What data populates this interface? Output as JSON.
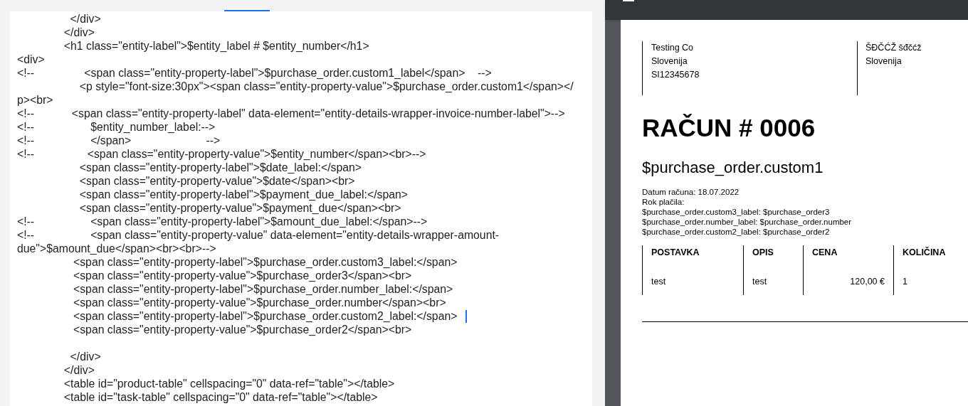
{
  "editor": {
    "lines": [
      {
        "kind": "code",
        "text": "                 </div>"
      },
      {
        "kind": "code",
        "text": "               </div>"
      },
      {
        "kind": "code",
        "text": "               <h1 class=\"entity-label\">$entity_label # $entity_number</h1>"
      },
      {
        "kind": "code",
        "text": "<div>"
      },
      {
        "kind": "code",
        "text": "<!--                <span class=\"entity-property-label\">$purchase_order.custom1_label</span>    -->"
      },
      {
        "kind": "code",
        "text": "                    <p style=\"font-size:30px\"><span class=\"entity-property-value\">$purchase_order.custom1</span></"
      },
      {
        "kind": "code",
        "text": "p><br>"
      },
      {
        "kind": "code",
        "text": "<!--            <span class=\"entity-property-label\" data-element=\"entity-details-wrapper-invoice-number-label\">-->"
      },
      {
        "kind": "code",
        "text": "<!--                  $entity_number_label:-->"
      },
      {
        "kind": "code",
        "text": "<!--                  </span>                        -->"
      },
      {
        "kind": "code",
        "text": "<!--                 <span class=\"entity-property-value\">$entity_number</span><br>-->"
      },
      {
        "kind": "code",
        "text": "                    <span class=\"entity-property-label\">$date_label:</span>"
      },
      {
        "kind": "code",
        "text": "                    <span class=\"entity-property-value\">$date</span><br>"
      },
      {
        "kind": "code",
        "text": "                    <span class=\"entity-property-label\">$payment_due_label:</span>"
      },
      {
        "kind": "code",
        "text": "                    <span class=\"entity-property-value\">$payment_due</span><br>"
      },
      {
        "kind": "code",
        "text": "<!--                  <span class=\"entity-property-label\">$amount_due_label:</span>-->"
      },
      {
        "kind": "code",
        "text": "<!--                  <span class=\"entity-property-value\" data-element=\"entity-details-wrapper-amount-"
      },
      {
        "kind": "code",
        "text": "due\">$amount_due</span><br><br>-->"
      },
      {
        "kind": "code",
        "text": "                  <span class=\"entity-property-label\">$purchase_order.custom3_label:</span>"
      },
      {
        "kind": "code",
        "text": "                  <span class=\"entity-property-value\">$purchase_order3</span><br>"
      },
      {
        "kind": "code",
        "text": "                  <span class=\"entity-property-label\">$purchase_order.number_label:</span>"
      },
      {
        "kind": "code",
        "text": "                  <span class=\"entity-property-value\">$purchase_order.number</span><br>"
      },
      {
        "kind": "cursor",
        "text": "                  <span class=\"entity-property-label\">$purchase_order.custom2_label:</span>"
      },
      {
        "kind": "code",
        "text": "                  <span class=\"entity-property-value\">$purchase_order2</span><br>"
      },
      {
        "kind": "blank"
      },
      {
        "kind": "code",
        "text": "                 </div>"
      },
      {
        "kind": "code",
        "text": "               </div>"
      },
      {
        "kind": "code",
        "text": "               <table id=\"product-table\" cellspacing=\"0\" data-ref=\"table\"></table>"
      },
      {
        "kind": "code",
        "text": "               <table id=\"task-table\" cellspacing=\"0\" data-ref=\"table\"></table>"
      }
    ]
  },
  "preview": {
    "sender": [
      "Testing Co",
      "Slovenija",
      "SI12345678"
    ],
    "client": [
      "ŠĐČĆŽ šđčćž",
      "Slovenija"
    ],
    "title": "RAČUN # 0006",
    "subtitle": "$purchase_order.custom1",
    "details": [
      "Datum računa: 18.07.2022",
      "Rok plačila:",
      "$purchase_order.custom3_label: $purchase_order3",
      "$purchase_order.number_label: $purchase_order.number",
      "$purchase_order.custom2_label: $purchase_order2"
    ],
    "table": {
      "columns": [
        "POSTAVKA",
        "OPIS",
        "CENA",
        "KOLIČINA"
      ],
      "rows": [
        [
          "test",
          "test",
          "120,00 €",
          "1"
        ]
      ]
    }
  }
}
